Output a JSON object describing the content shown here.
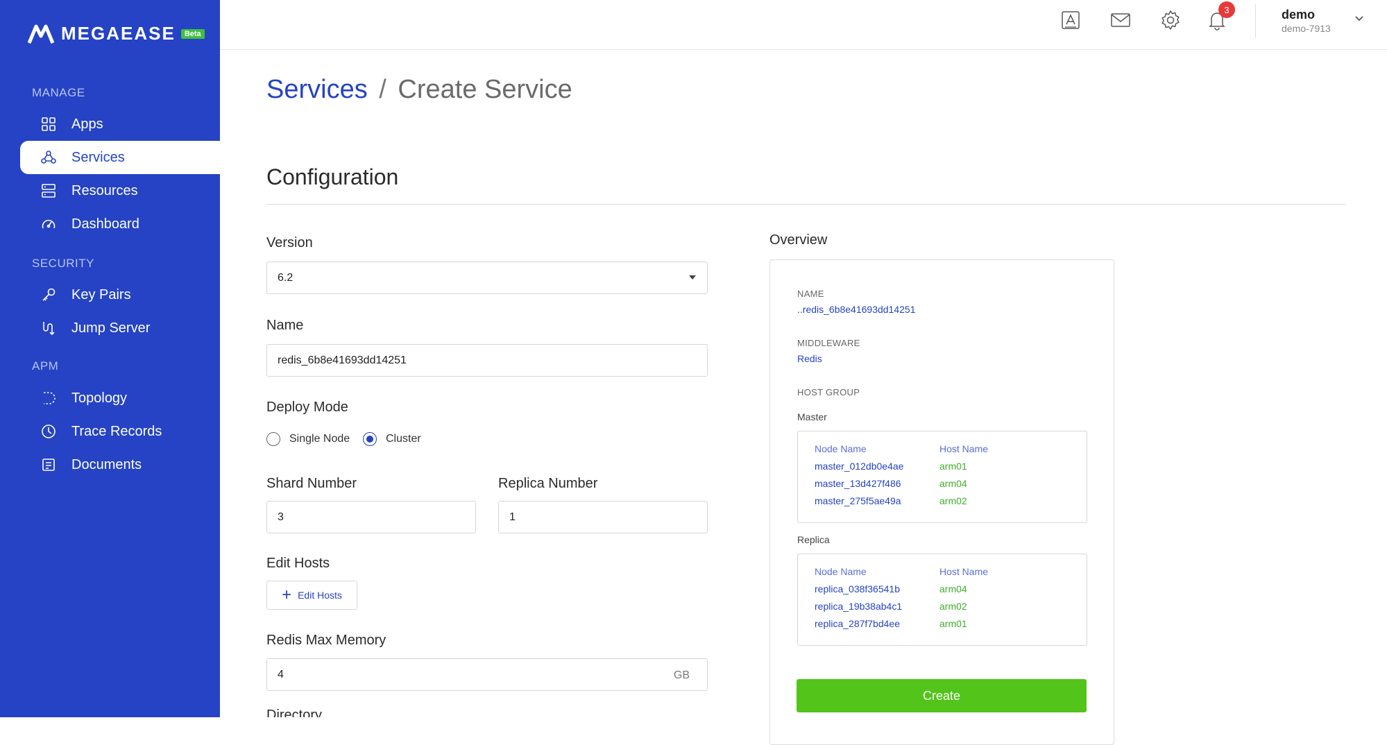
{
  "brand": {
    "name": "MEGAEASE",
    "badge": "Beta"
  },
  "sidebar": {
    "sections": [
      {
        "label": "MANAGE"
      },
      {
        "label": "SECURITY"
      },
      {
        "label": "APM"
      }
    ],
    "items": [
      {
        "label": "Apps",
        "icon": "apps-icon"
      },
      {
        "label": "Services",
        "icon": "services-icon",
        "active": true
      },
      {
        "label": "Resources",
        "icon": "resources-icon"
      },
      {
        "label": "Dashboard",
        "icon": "dashboard-icon"
      },
      {
        "label": "Key Pairs",
        "icon": "key-icon"
      },
      {
        "label": "Jump Server",
        "icon": "jump-server-icon"
      },
      {
        "label": "Topology",
        "icon": "topology-icon"
      },
      {
        "label": "Trace Records",
        "icon": "clock-icon"
      },
      {
        "label": "Documents",
        "icon": "document-icon"
      }
    ]
  },
  "header": {
    "notification_count": "3",
    "user": {
      "name": "demo",
      "id": "demo-7913"
    }
  },
  "breadcrumb": {
    "parent": "Services",
    "separator": "/",
    "current": "Create Service"
  },
  "config": {
    "title": "Configuration",
    "version": {
      "label": "Version",
      "value": "6.2"
    },
    "name": {
      "label": "Name",
      "value": "redis_6b8e41693dd14251"
    },
    "deploy_mode": {
      "label": "Deploy Mode",
      "options": [
        "Single Node",
        "Cluster"
      ],
      "selected": "Cluster"
    },
    "shard": {
      "label": "Shard Number",
      "value": "3"
    },
    "replica": {
      "label": "Replica Number",
      "value": "1"
    },
    "edit_hosts": {
      "label": "Edit Hosts",
      "button": "Edit Hosts"
    },
    "max_memory": {
      "label": "Redis Max Memory",
      "value": "4",
      "unit": "GB"
    },
    "next_label": "Directory"
  },
  "overview": {
    "title": "Overview",
    "name_key": "NAME",
    "name_val": "..redis_6b8e41693dd14251",
    "middleware_key": "MIDDLEWARE",
    "middleware_val": "Redis",
    "host_group_key": "HOST GROUP",
    "columns": {
      "node": "Node Name",
      "host": "Host Name"
    },
    "master": {
      "label": "Master",
      "rows": [
        {
          "node": "master_012db0e4ae",
          "host": "arm01"
        },
        {
          "node": "master_13d427f486",
          "host": "arm04"
        },
        {
          "node": "master_275f5ae49a",
          "host": "arm02"
        }
      ]
    },
    "replica": {
      "label": "Replica",
      "rows": [
        {
          "node": "replica_038f36541b",
          "host": "arm04"
        },
        {
          "node": "replica_19b38ab4c1",
          "host": "arm02"
        },
        {
          "node": "replica_287f7bd4ee",
          "host": "arm01"
        }
      ]
    },
    "create_button": "Create"
  },
  "colors": {
    "primary": "#2543c4",
    "success": "#52c41a",
    "host_green": "#3fae29",
    "badge_red": "#e53b3b"
  }
}
